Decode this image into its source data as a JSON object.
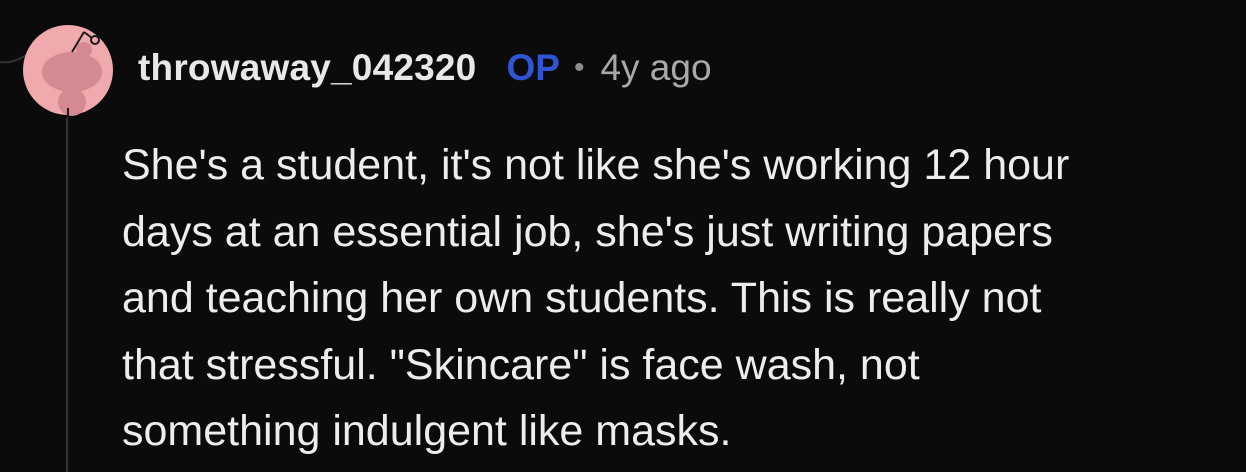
{
  "comment": {
    "author": "throwaway_042320",
    "op_badge": "OP",
    "separator": "•",
    "timestamp": "4y ago",
    "avatar_icon": "snoo-avatar-icon",
    "body_lines": [
      "She's a student, it's not like she's working 12 hour",
      "days at an essential job, she's just writing papers",
      "and teaching her own students. This is really not",
      "that stressful. \"Skincare\" is face wash, not",
      "something indulgent like masks."
    ]
  },
  "colors": {
    "background": "#0b0b0b",
    "op_badge": "#2f55d4",
    "avatar": "#f0a9ad"
  }
}
